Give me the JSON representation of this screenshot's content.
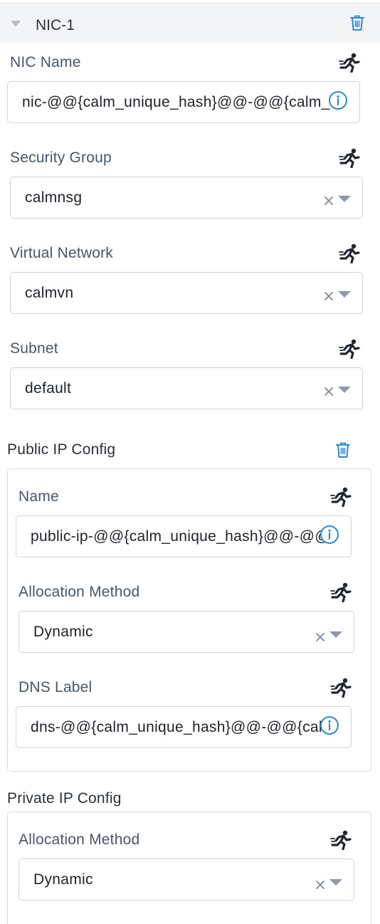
{
  "nic": {
    "title": "NIC-1",
    "fields": {
      "nic_name": {
        "label": "NIC Name",
        "value": "nic-@@{calm_unique_hash}@@-@@{calm_a"
      },
      "security_group": {
        "label": "Security Group",
        "value": "calmnsg"
      },
      "virtual_network": {
        "label": "Virtual Network",
        "value": "calmvn"
      },
      "subnet": {
        "label": "Subnet",
        "value": "default"
      }
    }
  },
  "public_ip": {
    "title": "Public IP Config",
    "fields": {
      "name": {
        "label": "Name",
        "value": "public-ip-@@{calm_unique_hash}@@-@@"
      },
      "allocation_method": {
        "label": "Allocation Method",
        "value": "Dynamic"
      },
      "dns_label": {
        "label": "DNS Label",
        "value": "dns-@@{calm_unique_hash}@@-@@{calm"
      }
    }
  },
  "private_ip": {
    "title": "Private IP Config",
    "fields": {
      "allocation_method": {
        "label": "Allocation Method",
        "value": "Dynamic"
      }
    }
  },
  "icons": {
    "run": "runner-icon",
    "trash": "trash-icon",
    "info": "info-icon",
    "clear": "clear-icon",
    "dropdown": "dropdown-arrow-icon",
    "collapse": "collapse-caret-icon"
  },
  "colors": {
    "accent_blue": "#2c8ad6",
    "header_bg": "#f2f4f6",
    "border": "#cfd6dd",
    "label": "#4b5662"
  }
}
